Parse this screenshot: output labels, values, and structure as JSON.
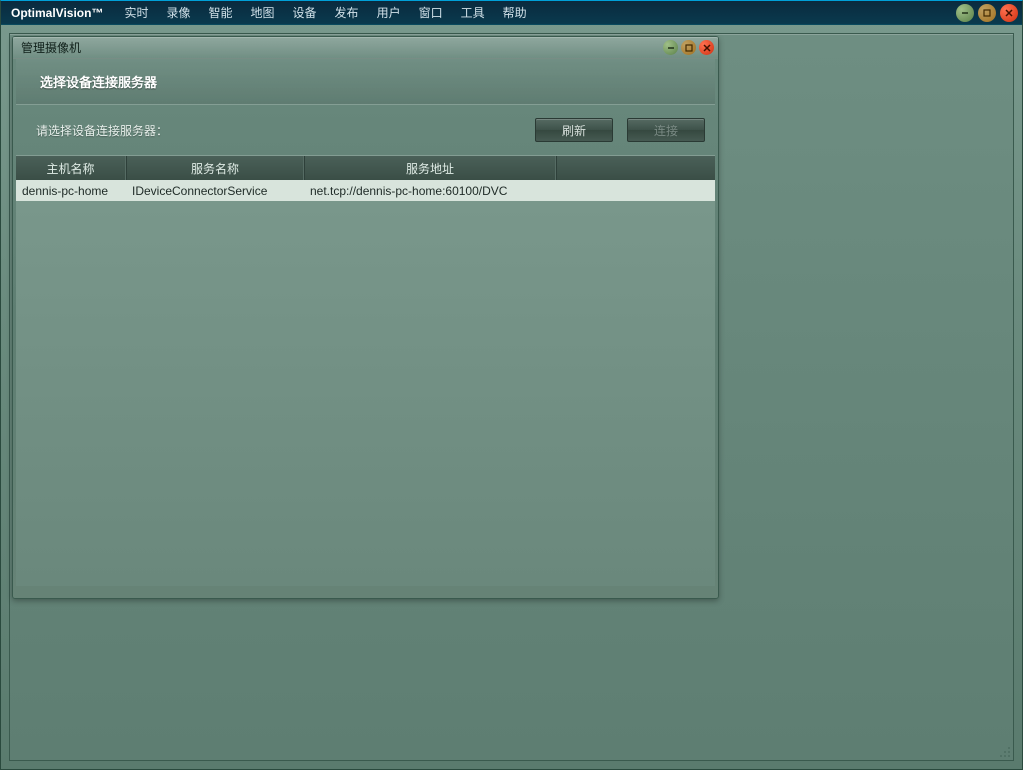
{
  "app": {
    "brand": "OptimalVision™"
  },
  "menu": {
    "items": [
      "实时",
      "录像",
      "智能",
      "地图",
      "设备",
      "发布",
      "用户",
      "窗口",
      "工具",
      "帮助"
    ]
  },
  "dialog": {
    "title": "管理摄像机",
    "header": "选择设备连接服务器",
    "prompt": "请选择设备连接服务器：",
    "buttons": {
      "refresh": "刷新",
      "connect": "连接"
    },
    "columns": {
      "host": "主机名称",
      "service": "服务名称",
      "address": "服务地址"
    },
    "rows": [
      {
        "host": "dennis-pc-home",
        "service": "IDeviceConnectorService",
        "address": "net.tcp://dennis-pc-home:60100/DVC",
        "selected": true
      }
    ]
  }
}
